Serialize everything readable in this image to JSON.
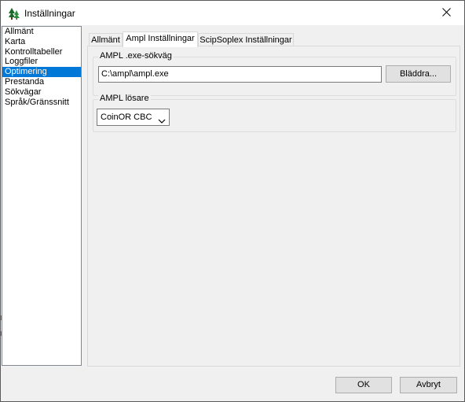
{
  "window": {
    "title": "Inställningar",
    "icons": {
      "app": "tree-logo-icon",
      "close": "close-icon"
    }
  },
  "sidebar": {
    "items": [
      {
        "label": "Allmänt",
        "selected": false
      },
      {
        "label": "Karta",
        "selected": false
      },
      {
        "label": "Kontrolltabeller",
        "selected": false
      },
      {
        "label": "Loggfiler",
        "selected": false
      },
      {
        "label": "Optimering",
        "selected": true
      },
      {
        "label": "Prestanda",
        "selected": false
      },
      {
        "label": "Sökvägar",
        "selected": false
      },
      {
        "label": "Språk/Gränssnitt",
        "selected": false
      }
    ]
  },
  "tabs": [
    {
      "label": "Allmänt",
      "active": false
    },
    {
      "label": "Ampl Inställningar",
      "active": true
    },
    {
      "label": "ScipSoplex Inställningar",
      "active": false
    }
  ],
  "ampl_path": {
    "legend": "AMPL .exe-sökväg",
    "value": "C:\\ampl\\ampl.exe",
    "browse_label": "Bläddra..."
  },
  "ampl_solver": {
    "legend": "AMPL lösare",
    "selected": "CoinOR CBC",
    "icon": "chevron-down-icon"
  },
  "footer": {
    "ok_label": "OK",
    "cancel_label": "Avbryt"
  },
  "colors": {
    "selection": "#0078d7",
    "window_bg": "#f0f0f0"
  }
}
